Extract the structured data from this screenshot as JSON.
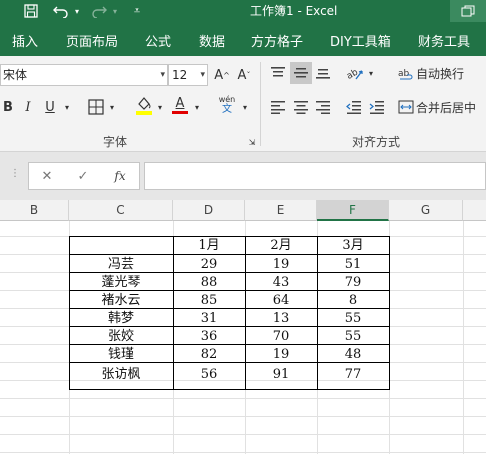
{
  "titlebar": {
    "title": "工作簿1  -  Excel",
    "icons": [
      "save-icon",
      "undo-icon",
      "redo-icon",
      "customize-qat-icon",
      "restore-icon"
    ],
    "background": "#217346"
  },
  "tabs": [
    "插入",
    "页面布局",
    "公式",
    "数据",
    "方方格子",
    "DIY工具箱",
    "财务工具"
  ],
  "ribbon": {
    "font_name": "宋体",
    "font_size": "12",
    "grow_font": "A^",
    "shrink_font": "Aˇ",
    "bold": "B",
    "italic": "I",
    "underline": "U",
    "font_color_letter": "A",
    "wen_top": "wén",
    "wen_bottom": "文",
    "wrap_text": "自动换行",
    "merge_center": "合并后居中",
    "font_group_label": "字体",
    "align_group_label": "对齐方式",
    "highlight_color": "#ffff00",
    "font_color": "#e00000"
  },
  "formula_bar": {
    "cancel": "✕",
    "enter": "✓",
    "fx": "fx",
    "value": ""
  },
  "columns": [
    "B",
    "C",
    "D",
    "E",
    "F",
    "G"
  ],
  "selected_column": "F",
  "table": {
    "headers": [
      "",
      "1月",
      "2月",
      "3月"
    ],
    "rows": [
      [
        "冯芸",
        "29",
        "19",
        "51"
      ],
      [
        "蓬光琴",
        "88",
        "43",
        "79"
      ],
      [
        "褚水云",
        "85",
        "64",
        "8"
      ],
      [
        "韩梦",
        "31",
        "13",
        "55"
      ],
      [
        "张姣",
        "36",
        "70",
        "55"
      ],
      [
        "钱瑾",
        "82",
        "19",
        "48"
      ],
      [
        "张访枫",
        "56",
        "91",
        "77"
      ]
    ]
  }
}
